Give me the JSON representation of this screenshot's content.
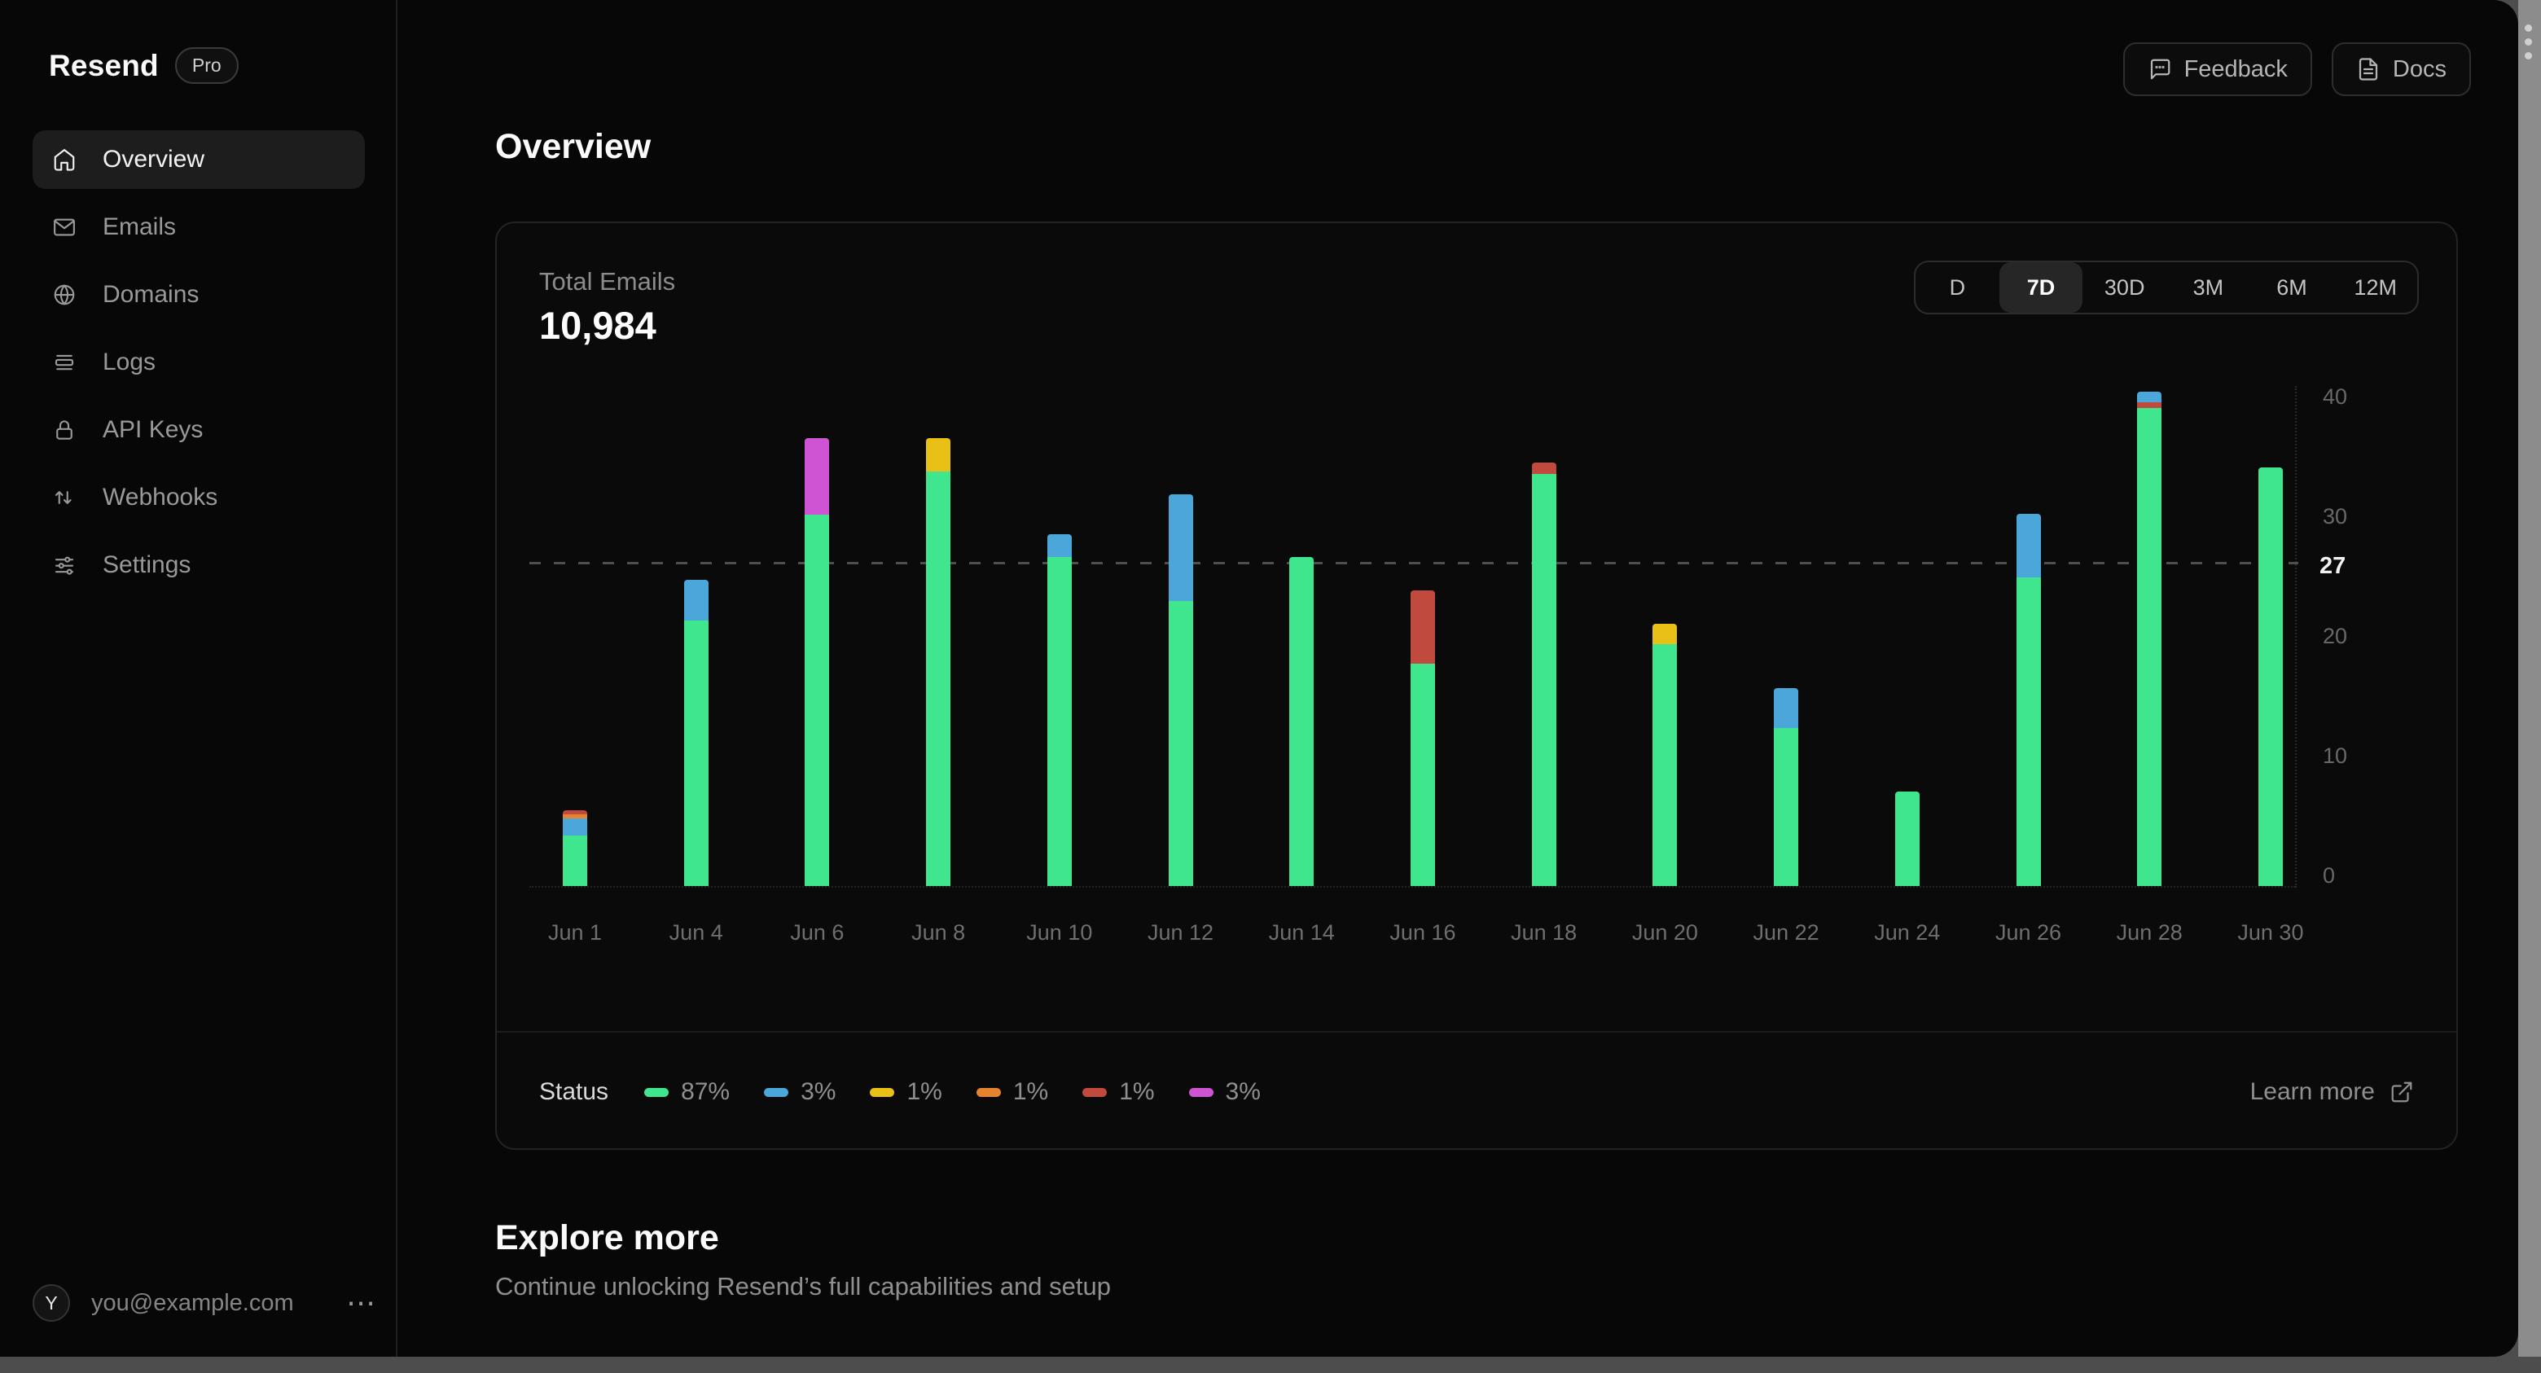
{
  "app": {
    "name": "Resend",
    "plan_badge": "Pro"
  },
  "sidebar": {
    "items": [
      {
        "label": "Overview",
        "icon": "home",
        "active": true
      },
      {
        "label": "Emails",
        "icon": "mail",
        "active": false
      },
      {
        "label": "Domains",
        "icon": "globe",
        "active": false
      },
      {
        "label": "Logs",
        "icon": "logs",
        "active": false
      },
      {
        "label": "API Keys",
        "icon": "lock",
        "active": false
      },
      {
        "label": "Webhooks",
        "icon": "arrows-up-down",
        "active": false
      },
      {
        "label": "Settings",
        "icon": "sliders",
        "active": false
      }
    ],
    "user": {
      "avatar_initial": "Y",
      "email": "you@example.com"
    }
  },
  "header": {
    "feedback_label": "Feedback",
    "docs_label": "Docs"
  },
  "main": {
    "page_title": "Overview",
    "stat_label": "Total Emails",
    "stat_value": "10,984"
  },
  "range_selector": {
    "options": [
      "D",
      "7D",
      "30D",
      "3M",
      "6M",
      "12M"
    ],
    "selected": "7D"
  },
  "chart_data": {
    "type": "bar",
    "stacked": true,
    "title": "Total Emails",
    "xlabel": "",
    "ylabel": "",
    "y_ticks": [
      0,
      10,
      20,
      30,
      40
    ],
    "ylim": [
      0,
      41.5
    ],
    "grid": "none",
    "threshold": {
      "value": 27,
      "label": "27"
    },
    "legend_position": "bottom-left",
    "colors": {
      "green": "#40e68e",
      "blue": "#4ba7d9",
      "yellow": "#e9c116",
      "orange": "#e5832f",
      "red": "#c14a3e",
      "magenta": "#cf54d4"
    },
    "legend": {
      "title": "Status",
      "entries": [
        {
          "color_key": "green",
          "label": "87%"
        },
        {
          "color_key": "blue",
          "label": "3%"
        },
        {
          "color_key": "yellow",
          "label": "1%"
        },
        {
          "color_key": "orange",
          "label": "1%"
        },
        {
          "color_key": "red",
          "label": "1%"
        },
        {
          "color_key": "magenta",
          "label": "3%"
        }
      ]
    },
    "bars": [
      {
        "label": "Jun 1",
        "segments": [
          [
            "green",
            4.2
          ],
          [
            "blue",
            1.45
          ],
          [
            "orange",
            0.35
          ],
          [
            "red",
            0.35
          ]
        ]
      },
      {
        "label": "Jun 4",
        "segments": [
          [
            "green",
            22.2
          ],
          [
            "blue",
            3.4
          ]
        ]
      },
      {
        "label": "Jun 6",
        "segments": [
          [
            "green",
            31.0
          ],
          [
            "magenta",
            6.4
          ]
        ]
      },
      {
        "label": "Jun 8",
        "segments": [
          [
            "green",
            34.6
          ],
          [
            "yellow",
            2.8
          ]
        ]
      },
      {
        "label": "Jun 10",
        "segments": [
          [
            "green",
            27.5
          ],
          [
            "blue",
            1.9
          ]
        ]
      },
      {
        "label": "Jun 12",
        "segments": [
          [
            "green",
            23.8
          ],
          [
            "blue",
            8.9
          ]
        ]
      },
      {
        "label": "Jun 14",
        "segments": [
          [
            "green",
            27.5
          ]
        ]
      },
      {
        "label": "Jun 16",
        "segments": [
          [
            "green",
            18.6
          ],
          [
            "red",
            6.1
          ]
        ]
      },
      {
        "label": "Jun 18",
        "segments": [
          [
            "green",
            34.4
          ],
          [
            "red",
            1.0
          ]
        ]
      },
      {
        "label": "Jun 20",
        "segments": [
          [
            "green",
            20.2
          ],
          [
            "yellow",
            1.7
          ]
        ]
      },
      {
        "label": "Jun 22",
        "segments": [
          [
            "green",
            13.2
          ],
          [
            "blue",
            3.3
          ]
        ]
      },
      {
        "label": "Jun 24",
        "segments": [
          [
            "green",
            7.9
          ]
        ]
      },
      {
        "label": "Jun 26",
        "segments": [
          [
            "green",
            25.8
          ],
          [
            "blue",
            5.3
          ]
        ]
      },
      {
        "label": "Jun 28",
        "segments": [
          [
            "green",
            39.9
          ],
          [
            "red",
            0.5
          ],
          [
            "blue",
            0.9
          ]
        ]
      },
      {
        "label": "Jun 30",
        "segments": [
          [
            "green",
            35.0
          ]
        ]
      }
    ]
  },
  "card_footer": {
    "learn_more_label": "Learn more"
  },
  "explore": {
    "title": "Explore more",
    "subtitle": "Continue unlocking Resend’s full capabilities and setup"
  }
}
